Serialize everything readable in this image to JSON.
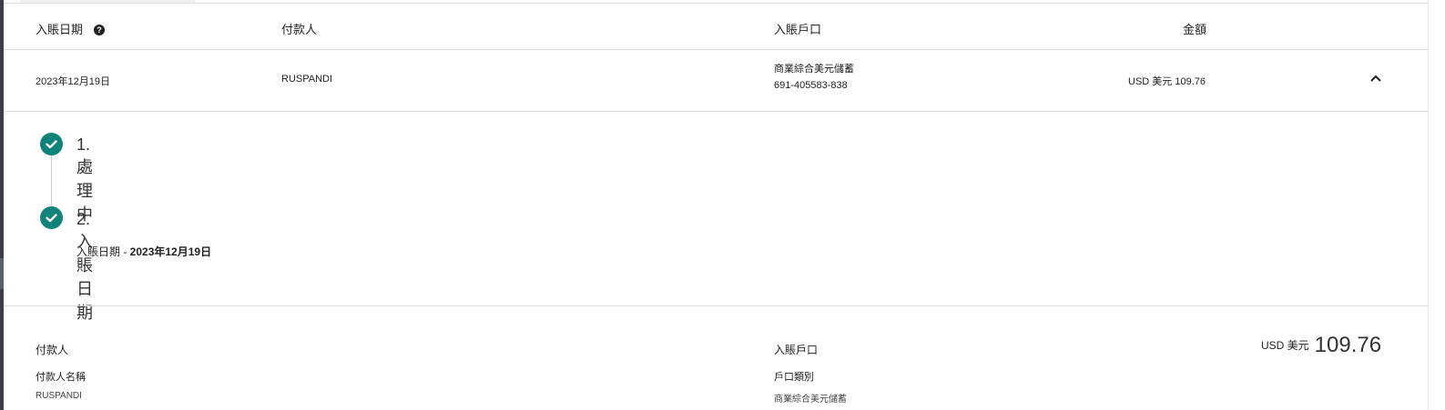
{
  "header": {
    "col_date": "入賬日期",
    "col_payer": "付款人",
    "col_account": "入賬戶口",
    "col_amount": "金額"
  },
  "row": {
    "date": "2023年12月19日",
    "payer": "RUSPANDI",
    "account_name": "商業綜合美元儲蓄",
    "account_number": "691-405583-838",
    "amount": "USD 美元 109.76"
  },
  "steps": [
    {
      "title": "1. 處理中"
    },
    {
      "title": "2. 入賬日期",
      "detail_label": "入賬日期 - ",
      "detail_value": "2023年12月19日"
    }
  ],
  "details": {
    "payer_heading": "付款人",
    "payer_name_label": "付款人名稱",
    "payer_name_value": "RUSPANDI",
    "account_heading": "入賬戶口",
    "account_type_label": "戶口類別",
    "account_type_value": "商業綜合美元儲蓄",
    "amount_currency": "USD 美元",
    "amount_value": "109.76"
  },
  "colors": {
    "accent": "#0f8279"
  },
  "icons": {
    "help": "help-circle-icon",
    "collapse": "chevron-up-icon",
    "step_done": "check-circle-icon"
  }
}
